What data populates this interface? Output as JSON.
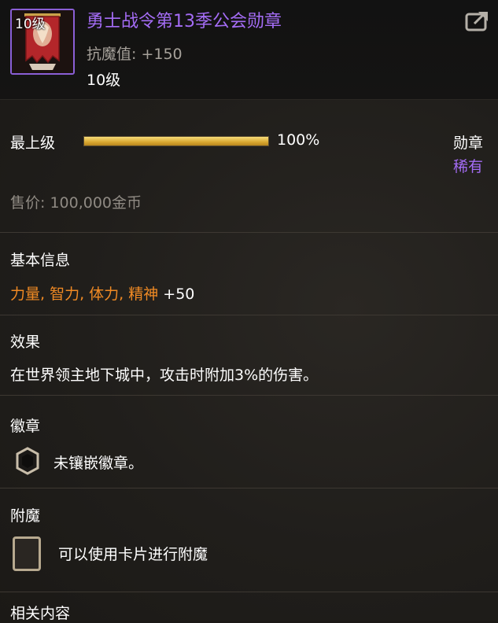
{
  "item": {
    "icon_level": "10级",
    "name": "勇士战令第13季公会勋章",
    "stat": "抗魔值: +150",
    "level": "10级"
  },
  "progress": {
    "label": "最上级",
    "value_text": "100%",
    "fraction": 1.0
  },
  "type": "勋章",
  "rarity": "稀有",
  "price": "售价: 100,000金币",
  "basic_info": {
    "title": "基本信息",
    "stats_names": "力量, 智力, 体力, 精神",
    "stats_value": "+50"
  },
  "effect": {
    "title": "效果",
    "text": "在世界领主地下城中，攻击时附加3%的伤害。"
  },
  "emblem": {
    "title": "徽章",
    "text": "未镶嵌徽章。"
  },
  "enchant": {
    "title": "附魔",
    "text": "可以使用卡片进行附魔"
  },
  "related": {
    "title": "相关内容"
  },
  "colors": {
    "rarity_purple": "#a46cf5",
    "stat_orange": "#f08a24",
    "progress_gold": "#d9a731"
  },
  "icons": {
    "share": "share-icon",
    "emblem_slot": "emblem-slot-icon",
    "card_slot": "card-slot-icon"
  }
}
